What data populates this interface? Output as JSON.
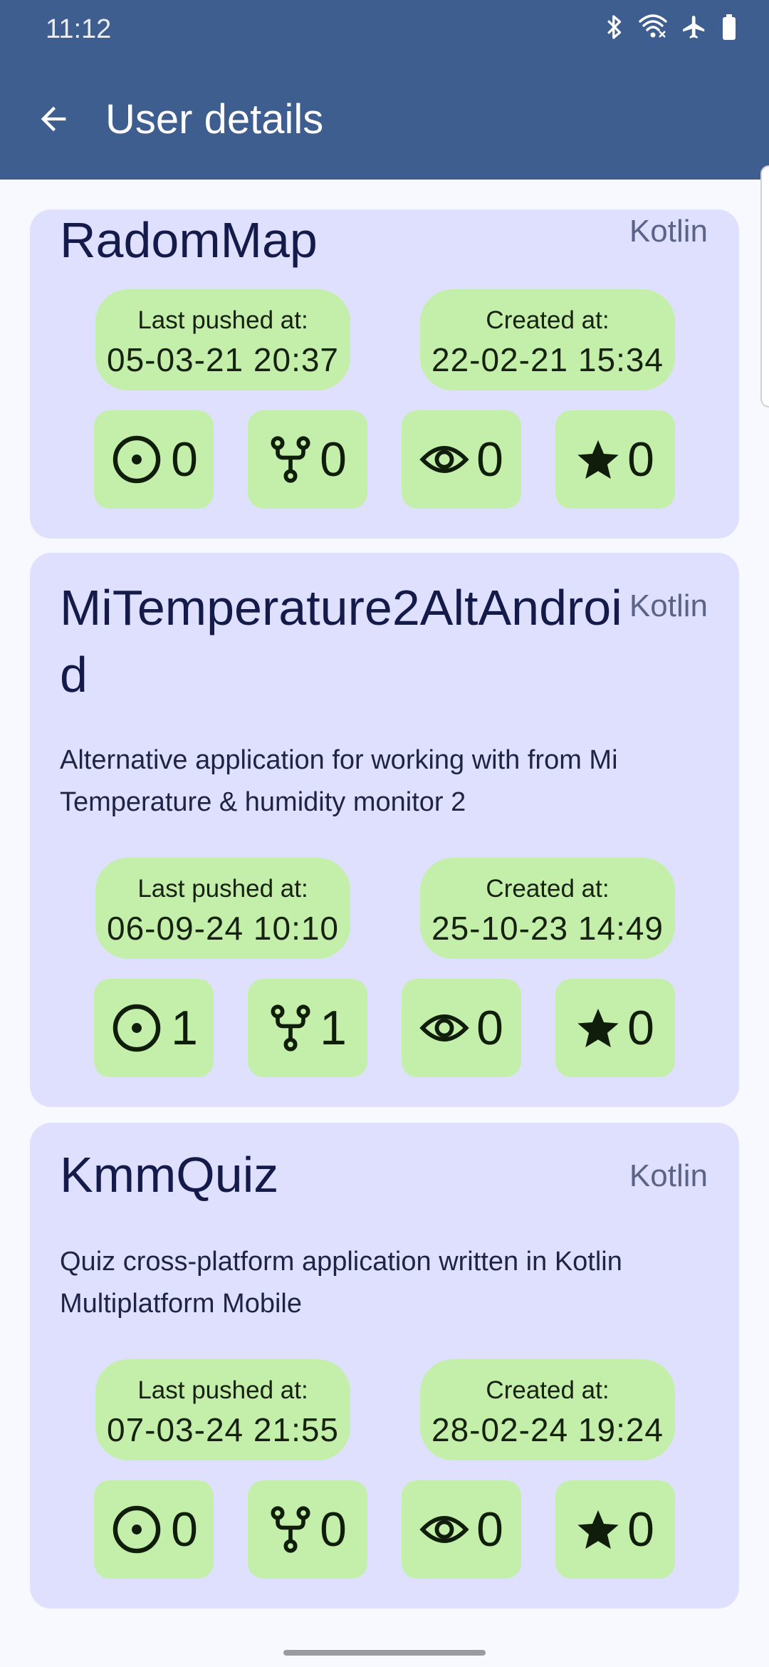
{
  "status_bar": {
    "time": "11:12",
    "icons": [
      "bluetooth-icon",
      "wifi-icon",
      "airplane-icon",
      "battery-icon"
    ]
  },
  "app_bar": {
    "title": "User details",
    "back_icon": "arrow-back-icon"
  },
  "colors": {
    "app_bar": "#3d5e8f",
    "card": "#dfe0fd",
    "chip": "#c4efaa",
    "title": "#141b4a",
    "language": "#5b6488"
  },
  "repos": [
    {
      "name": "RadomMap",
      "language": "Kotlin",
      "description": "",
      "last_pushed_label": "Last pushed at:",
      "last_pushed": "05-03-21 20:37",
      "created_label": "Created at:",
      "created": "22-02-21 15:34",
      "issues": "0",
      "forks": "0",
      "watchers": "0",
      "stars": "0"
    },
    {
      "name": "MiTemperature2AltAndroid",
      "language": "Kotlin",
      "description": "Alternative application for working with from Mi Temperature & humidity monitor 2",
      "last_pushed_label": "Last pushed at:",
      "last_pushed": "06-09-24 10:10",
      "created_label": "Created at:",
      "created": "25-10-23 14:49",
      "issues": "1",
      "forks": "1",
      "watchers": "0",
      "stars": "0"
    },
    {
      "name": "KmmQuiz",
      "language": "Kotlin",
      "description": "Quiz cross-platform application written in Kotlin Multiplatform Mobile",
      "last_pushed_label": "Last pushed at:",
      "last_pushed": "07-03-24 21:55",
      "created_label": "Created at:",
      "created": "28-02-24 19:24",
      "issues": "0",
      "forks": "0",
      "watchers": "0",
      "stars": "0"
    }
  ]
}
